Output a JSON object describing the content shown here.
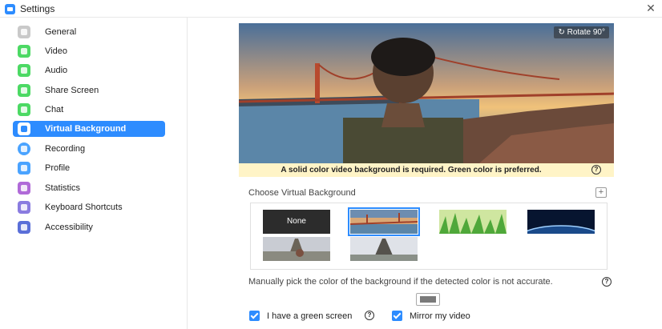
{
  "window": {
    "title": "Settings",
    "close_label": "✕"
  },
  "sidebar": {
    "items": [
      {
        "label": "General",
        "icon": "gear-icon",
        "color": "#c9c9c9"
      },
      {
        "label": "Video",
        "icon": "video-icon",
        "color": "#4cd964"
      },
      {
        "label": "Audio",
        "icon": "headphones-icon",
        "color": "#4cd964"
      },
      {
        "label": "Share Screen",
        "icon": "share-screen-icon",
        "color": "#4cd964"
      },
      {
        "label": "Chat",
        "icon": "chat-icon",
        "color": "#4cd964"
      },
      {
        "label": "Virtual Background",
        "icon": "virtual-background-icon",
        "color": "#2d8cff",
        "active": true
      },
      {
        "label": "Recording",
        "icon": "recording-icon",
        "color": "#4aa3ff"
      },
      {
        "label": "Profile",
        "icon": "profile-icon",
        "color": "#4aa3ff"
      },
      {
        "label": "Statistics",
        "icon": "statistics-icon",
        "color": "#b06ad8"
      },
      {
        "label": "Keyboard Shortcuts",
        "icon": "keyboard-icon",
        "color": "#8a7ce0"
      },
      {
        "label": "Accessibility",
        "icon": "accessibility-icon",
        "color": "#5a6fd8"
      }
    ]
  },
  "preview": {
    "rotate_label": "Rotate 90°"
  },
  "warning": {
    "text": "A solid color video background is required. Green color is preferred.",
    "help": "?"
  },
  "chooser": {
    "label": "Choose Virtual Background",
    "add": "+",
    "none_label": "None"
  },
  "manual": {
    "text": "Manually pick the color of the background if the detected color is not accurate.",
    "help": "?"
  },
  "options": {
    "green_screen": {
      "label": "I have a green screen",
      "checked": true,
      "help": "?"
    },
    "mirror": {
      "label": "Mirror my video",
      "checked": true
    }
  },
  "colors": {
    "accent": "#2d8cff",
    "warning_bg": "#fff4c7"
  }
}
